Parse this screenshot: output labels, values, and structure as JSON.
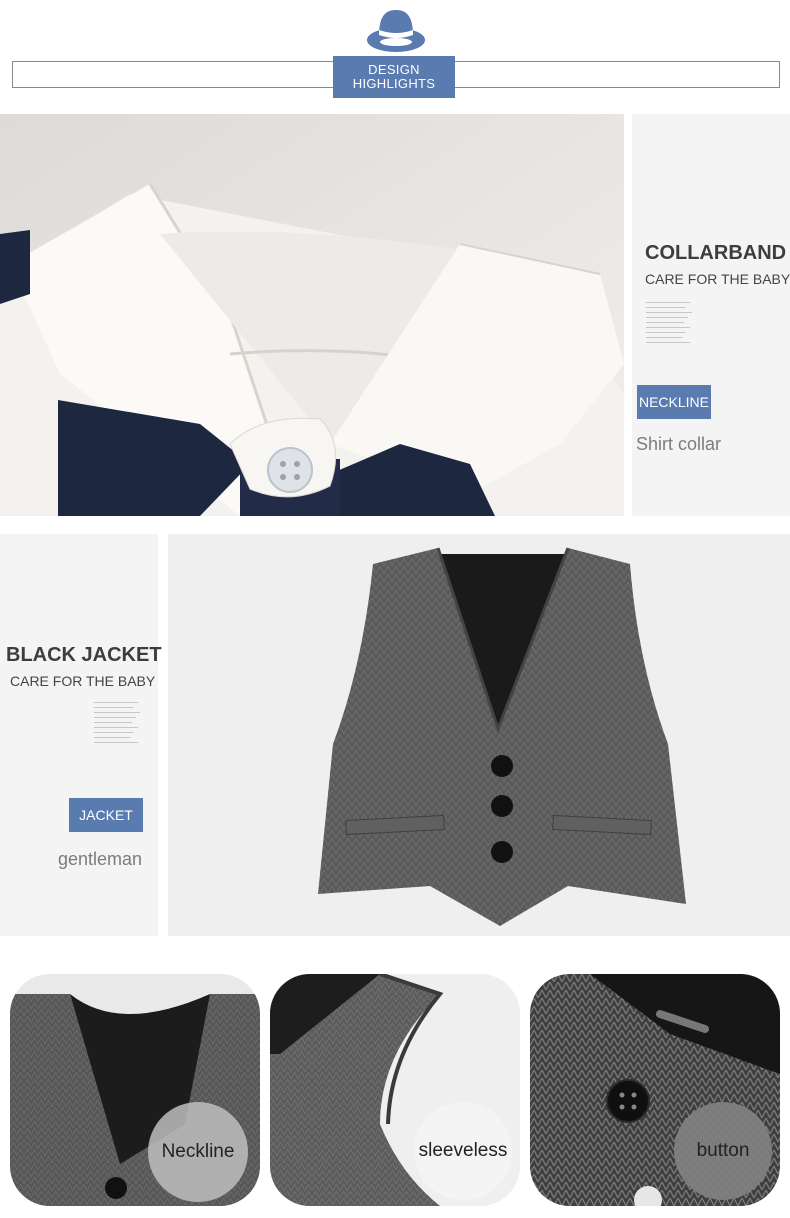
{
  "header": {
    "badge_line1": "DESIGN",
    "badge_line2": "HIGHLIGHTS",
    "accent_color": "#5a7bb0",
    "icon": "hat-icon"
  },
  "collar": {
    "title": "COLLARBAND",
    "subtitle": "CARE FOR THE BABY",
    "tag": "NECKLINE",
    "note": "Shirt collar"
  },
  "jacket": {
    "title": "BLACK JACKET",
    "subtitle": "CARE FOR THE BABY",
    "tag": "JACKET",
    "note": "gentleman"
  },
  "details": [
    {
      "label": "Neckline"
    },
    {
      "label": "sleeveless"
    },
    {
      "label": "button"
    }
  ]
}
